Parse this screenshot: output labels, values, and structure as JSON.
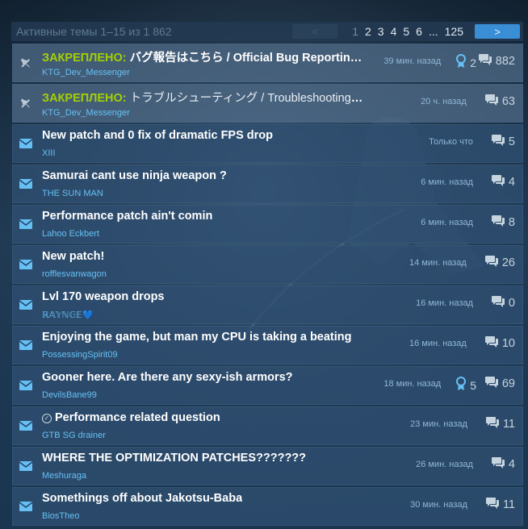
{
  "header": {
    "topic_count": "Активные темы 1–15 из 1 862",
    "prev_icon": "arrow-left-icon",
    "next_icon": "arrow-right-icon",
    "pages": [
      "1",
      "2",
      "3",
      "4",
      "5",
      "6",
      "...",
      "125"
    ],
    "current_page": "1"
  },
  "colors": {
    "accent": "#66c0f4",
    "pinned": "#a3cf06",
    "row": "#305072",
    "next_button": "#3a8ed6"
  },
  "topics": [
    {
      "pin_label": "ЗАКРЕПЛЕНО:",
      "title": "バグ報告はこちら / Official Bug Reporting ...",
      "author": "KTG_Dev_Messenger",
      "time": "39 мин. назад",
      "awards": "2",
      "replies": "882",
      "icon": "pin-icon"
    },
    {
      "pin_label": "ЗАКРЕПЛЕНО:",
      "title": "トラブルシューティング / Troubleshooting / 常見...",
      "author": "KTG_Dev_Messenger",
      "time": "20 ч. назад",
      "replies": "63",
      "icon": "pin-icon"
    },
    {
      "title": "New patch and 0 fix of dramatic FPS drop",
      "author": "XIII",
      "time": "Только что",
      "replies": "5",
      "icon": "envelope-icon"
    },
    {
      "title": "Samurai cant use ninja weapon ?",
      "author": "THE SUN MAN",
      "time": "6 мин. назад",
      "replies": "4",
      "icon": "envelope-icon"
    },
    {
      "title": "Performance patch ain't comin",
      "author": "Lahoo Eckbert",
      "time": "6 мин. назад",
      "replies": "8",
      "icon": "envelope-icon"
    },
    {
      "title": "New patch!",
      "author": "rofflesvanwagon",
      "time": "14 мин. назад",
      "replies": "26",
      "icon": "envelope-icon"
    },
    {
      "title": "Lvl 170 weapon drops",
      "author": "ℝ𝔸𝕐ℕ𝔾𝔼💙",
      "time": "16 мин. назад",
      "replies": "0",
      "icon": "envelope-icon"
    },
    {
      "title": "Enjoying the game, but man my CPU is taking a beating",
      "author": "PossessingSpirit09",
      "time": "16 мин. назад",
      "replies": "10",
      "icon": "envelope-icon"
    },
    {
      "title": "Gooner here. Are there any sexy-ish armors?",
      "author": "DevilsBane99",
      "time": "18 мин. назад",
      "awards": "5",
      "replies": "69",
      "icon": "envelope-icon"
    },
    {
      "title": "Performance related question",
      "answered": true,
      "author": "GTB SG drainer",
      "time": "23 мин. назад",
      "replies": "11",
      "icon": "envelope-icon"
    },
    {
      "title": "WHERE THE OPTIMIZATION PATCHES???????",
      "author": "Meshuraga",
      "time": "26 мин. назад",
      "replies": "4",
      "icon": "envelope-icon"
    },
    {
      "title": "Somethings off about Jakotsu-Baba",
      "author": "BiosTheo",
      "time": "30 мин. назад",
      "replies": "11",
      "icon": "envelope-icon"
    }
  ]
}
